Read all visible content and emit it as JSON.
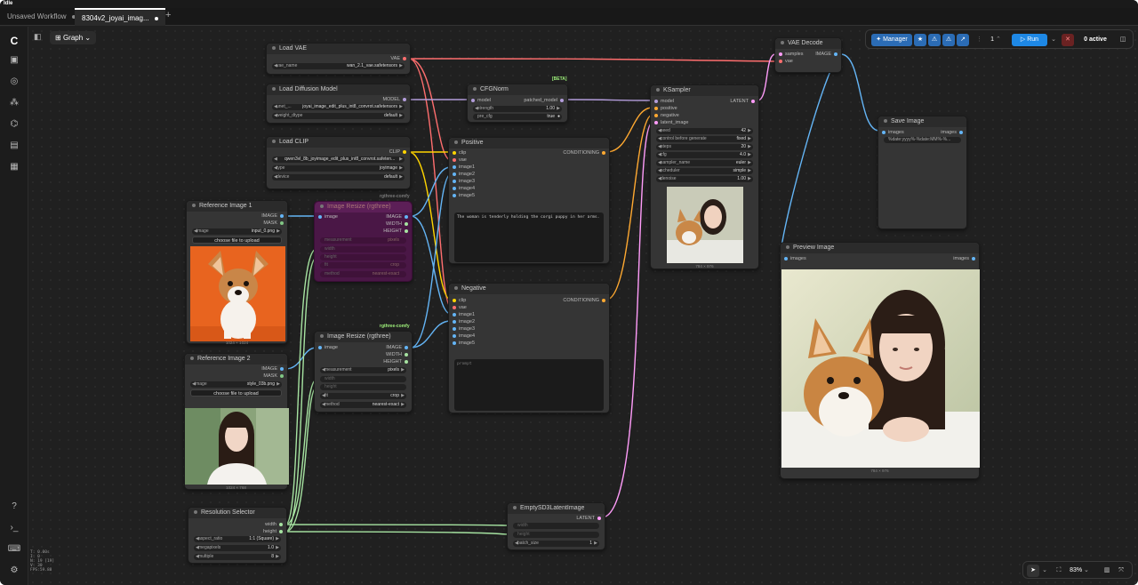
{
  "app": {
    "title": "Idle"
  },
  "tabs": [
    {
      "label": "Unsaved Workflow"
    },
    {
      "label": "8304v2_joyai_imag..."
    },
    {
      "label": "+"
    }
  ],
  "graph_button": {
    "label": "Graph"
  },
  "toolbar": {
    "manager": "Manager",
    "run_count": "1",
    "run": "Run",
    "active": "0 active"
  },
  "zoom": {
    "level": "83%"
  },
  "stats": {
    "l1": "T: 0.00s",
    "l2": "I: 0",
    "l3": "N: 19 [19]",
    "l4": "V: 30",
    "l5": "FPS:59.88"
  },
  "nodes": {
    "load_vae": {
      "title": "Load VAE",
      "out": "VAE",
      "w1_label": "vae_name",
      "w1_value": "wan_2.1_vae.safetensors"
    },
    "load_diffusion": {
      "title": "Load Diffusion Model",
      "out": "MODEL",
      "w1_label": "unet_...",
      "w1_value": "joyai_image_edit_plus_int8_convrot.safetensors",
      "w2_label": "weight_dtype",
      "w2_value": "default"
    },
    "load_clip": {
      "title": "Load CLIP",
      "out": "CLIP",
      "w1_value": "qwen3vl_8b_joyimage_edit_plus_int8_convrot.safeten...",
      "w2_label": "type",
      "w2_value": "joyimage",
      "w3_label": "device",
      "w3_value": "default"
    },
    "cfgnorm": {
      "title": "CFGNorm",
      "tag": "[BETA]",
      "in1": "model",
      "out1": "patched_model",
      "w1_label": "strength",
      "w1_value": "1.00",
      "w2_label": "pre_cfg",
      "w2_value": "true"
    },
    "positive": {
      "title": "Positive",
      "in": [
        "clip",
        "vae",
        "image1",
        "image2",
        "image3",
        "image4",
        "image5"
      ],
      "out": "CONDITIONING",
      "text": "The woman is tenderly holding the corgi puppy in her arms."
    },
    "negative": {
      "title": "Negative",
      "in": [
        "clip",
        "vae",
        "image1",
        "image2",
        "image3",
        "image4",
        "image5"
      ],
      "out": "CONDITIONING",
      "placeholder": "prompt"
    },
    "ksampler": {
      "title": "KSampler",
      "in": [
        "model",
        "positive",
        "negative",
        "latent_image"
      ],
      "out": "LATENT",
      "w": [
        {
          "l": "seed",
          "v": "42"
        },
        {
          "l": "control before generate",
          "v": "fixed"
        },
        {
          "l": "steps",
          "v": "20"
        },
        {
          "l": "cfg",
          "v": "4.0"
        },
        {
          "l": "sampler_name",
          "v": "euler"
        },
        {
          "l": "scheduler",
          "v": "simple"
        },
        {
          "l": "denoise",
          "v": "1.00"
        }
      ],
      "caption": "784 × 976"
    },
    "vae_decode": {
      "title": "VAE Decode",
      "in1": "samples",
      "in2": "vae",
      "out": "IMAGE"
    },
    "save_image": {
      "title": "Save Image",
      "in": "images",
      "out": "images",
      "w1": "%date:yyyy%-%date:MM%-%..."
    },
    "preview": {
      "title": "Preview Image",
      "in": "images",
      "out": "images",
      "caption": "784 × 976"
    },
    "ref1": {
      "title": "Reference Image 1",
      "out1": "IMAGE",
      "out2": "MASK",
      "w_label": "image",
      "w_value": "input_0.png",
      "upload": "choose file to upload",
      "caption": "1024 × 1024"
    },
    "ref2": {
      "title": "Reference Image 2",
      "out1": "IMAGE",
      "out2": "MASK",
      "w_label": "image",
      "w_value": "style_03b.png",
      "upload": "choose file to upload",
      "caption": "1024 × 768"
    },
    "resize1": {
      "title": "Image Resize (rgthree)",
      "tag": "rgthree-comfy",
      "in": "image",
      "out1": "IMAGE",
      "out2": "WIDTH",
      "out3": "HEIGHT",
      "w": [
        {
          "l": "measurement",
          "v": "pixels"
        },
        {
          "l": "width",
          "v": ""
        },
        {
          "l": "height",
          "v": ""
        },
        {
          "l": "fit",
          "v": "crop"
        },
        {
          "l": "method",
          "v": "nearest-exact"
        }
      ]
    },
    "resize2": {
      "title": "Image Resize (rgthree)",
      "tag": "rgthree-comfy",
      "in": "image",
      "out1": "IMAGE",
      "out2": "WIDTH",
      "out3": "HEIGHT",
      "w": [
        {
          "l": "measurement",
          "v": "pixels"
        },
        {
          "l": "width",
          "v": ""
        },
        {
          "l": "height",
          "v": ""
        },
        {
          "l": "fit",
          "v": "crop"
        },
        {
          "l": "method",
          "v": "nearest-exact"
        }
      ]
    },
    "resolution": {
      "title": "Resolution Selector",
      "out1": "width",
      "out2": "height",
      "w": [
        {
          "l": "aspect_ratio",
          "v": "1:1 (Square)"
        },
        {
          "l": "megapixels",
          "v": "1.0"
        },
        {
          "l": "multiple",
          "v": "8"
        }
      ]
    },
    "empty_latent": {
      "title": "EmptySD3LatentImage",
      "out": "LATENT",
      "w": [
        {
          "l": "width",
          "v": ""
        },
        {
          "l": "height",
          "v": ""
        },
        {
          "l": "batch_size",
          "v": "1"
        }
      ]
    }
  },
  "colors": {
    "vae": "#ff6e6e",
    "model": "#b39ddb",
    "clip": "#ffd500",
    "conditioning": "#ffa931",
    "image": "#64b5f6",
    "latent": "#ff9cf9",
    "int": "#a6e3a1",
    "accent": "#1e88e5"
  }
}
